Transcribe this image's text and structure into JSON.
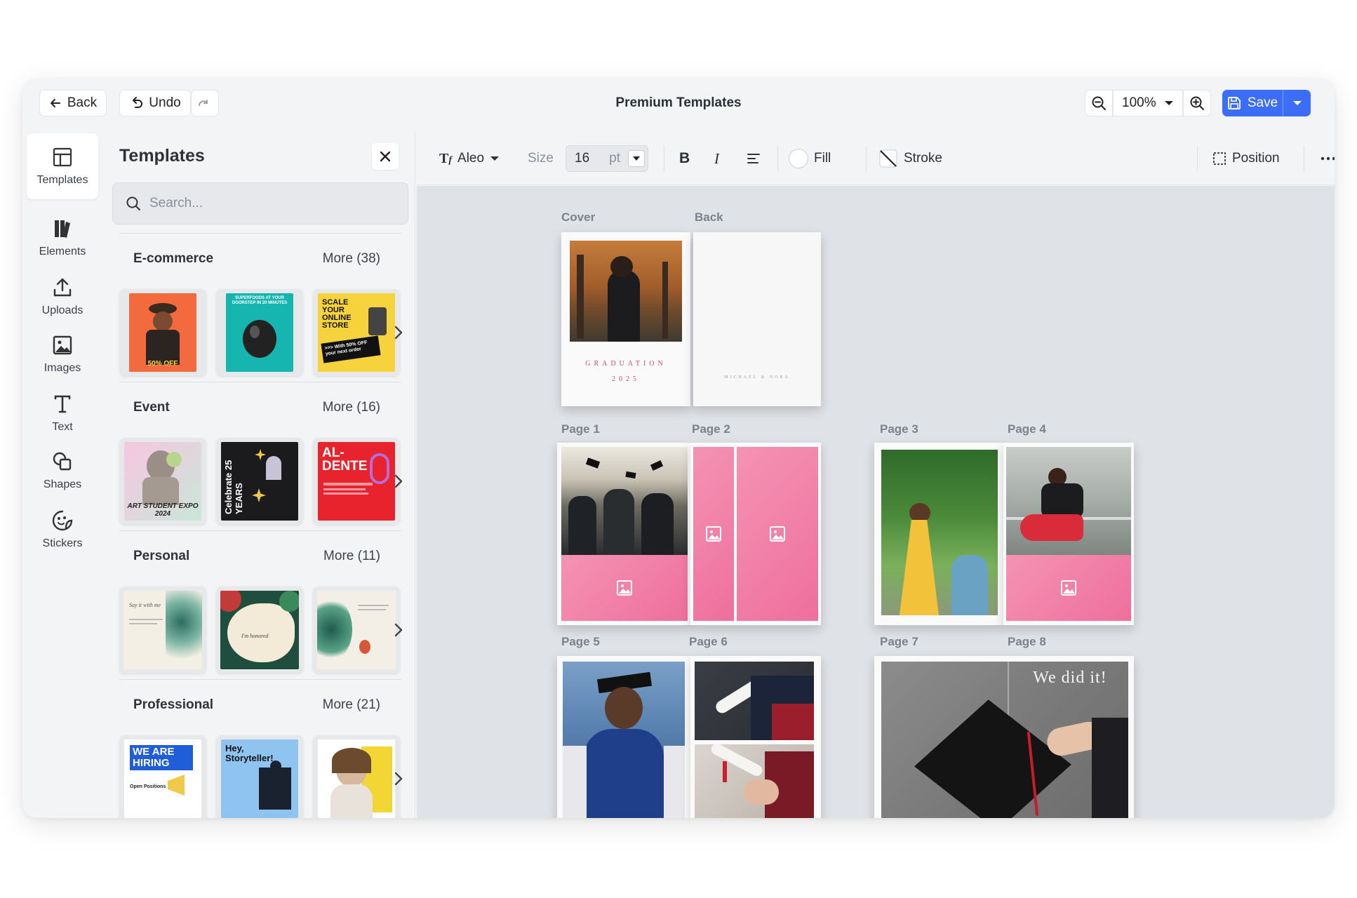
{
  "topbar": {
    "back_label": "Back",
    "undo_label": "Undo",
    "title": "Premium Templates",
    "zoom": "100%",
    "save_label": "Save"
  },
  "rail": {
    "items": [
      {
        "label": "Templates",
        "icon": "templates-icon"
      },
      {
        "label": "Elements",
        "icon": "elements-icon"
      },
      {
        "label": "Uploads",
        "icon": "upload-icon"
      },
      {
        "label": "Images",
        "icon": "image-icon"
      },
      {
        "label": "Text",
        "icon": "text-icon"
      },
      {
        "label": "Shapes",
        "icon": "shapes-icon"
      },
      {
        "label": "Stickers",
        "icon": "sticker-icon"
      }
    ]
  },
  "panel": {
    "title": "Templates",
    "search_placeholder": "Search...",
    "categories": [
      {
        "name": "E-commerce",
        "more": "More (38)",
        "thumb_texts": [
          "50% OFF",
          "SUPERFOODS AT YOUR DOORSTEP IN 20 MINUTES",
          "SCALE YOUR ONLINE STORE",
          ">>> With 50% OFF your next order"
        ]
      },
      {
        "name": "Event",
        "more": "More (16)",
        "thumb_texts": [
          "ART STUDENT EXPO 2024",
          "Celebrate 25 YEARS",
          "AL-DENTE"
        ]
      },
      {
        "name": "Personal",
        "more": "More (11)",
        "thumb_texts": [
          "Say it with me",
          "I'm honored"
        ]
      },
      {
        "name": "Professional",
        "more": "More (21)",
        "thumb_texts": [
          "WE ARE HIRING",
          "Open Positions",
          "Hey, Storyteller!"
        ]
      }
    ]
  },
  "format": {
    "font": "Aleo",
    "size_label": "Size",
    "size_value": "16",
    "size_unit": "pt",
    "fill_label": "Fill",
    "stroke_label": "Stroke",
    "position_label": "Position"
  },
  "canvas": {
    "labels": {
      "cover": "Cover",
      "back": "Back",
      "p1": "Page 1",
      "p2": "Page 2",
      "p3": "Page 3",
      "p4": "Page 4",
      "p5": "Page 5",
      "p6": "Page 6",
      "p7": "Page 7",
      "p8": "Page 8"
    },
    "cover_title": "GRADUATION",
    "cover_year": "2025",
    "back_text": "MICHAEL & NORA",
    "page8_caption": "We did it!"
  },
  "colors": {
    "accent": "#3b6df6",
    "pink": "#f27fa8"
  }
}
